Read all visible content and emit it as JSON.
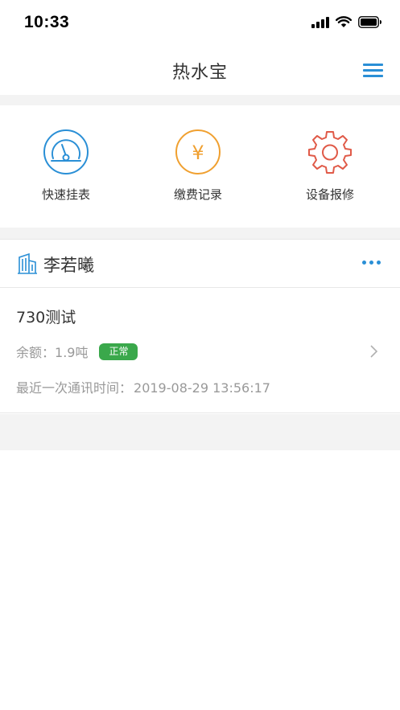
{
  "status_bar": {
    "time": "10:33"
  },
  "nav": {
    "title": "热水宝",
    "menu_icon": "hamburger-menu-icon"
  },
  "actions": [
    {
      "label": "快速挂表",
      "icon": "gauge-icon",
      "color": "#2a8fd6"
    },
    {
      "label": "缴费记录",
      "icon": "yen-coin-icon",
      "color": "#f0a030"
    },
    {
      "label": "设备报修",
      "icon": "gear-icon",
      "color": "#e05a48"
    }
  ],
  "card": {
    "user_name": "李若曦",
    "icon": "building-icon",
    "meter": {
      "name": "730测试",
      "balance_label": "余额：",
      "balance_value": "1.9吨",
      "status": "正常",
      "status_color": "#3aa84b",
      "last_comm_label": "最近一次通讯时间：",
      "last_comm_value": "2019-08-29 13:56:17"
    }
  }
}
